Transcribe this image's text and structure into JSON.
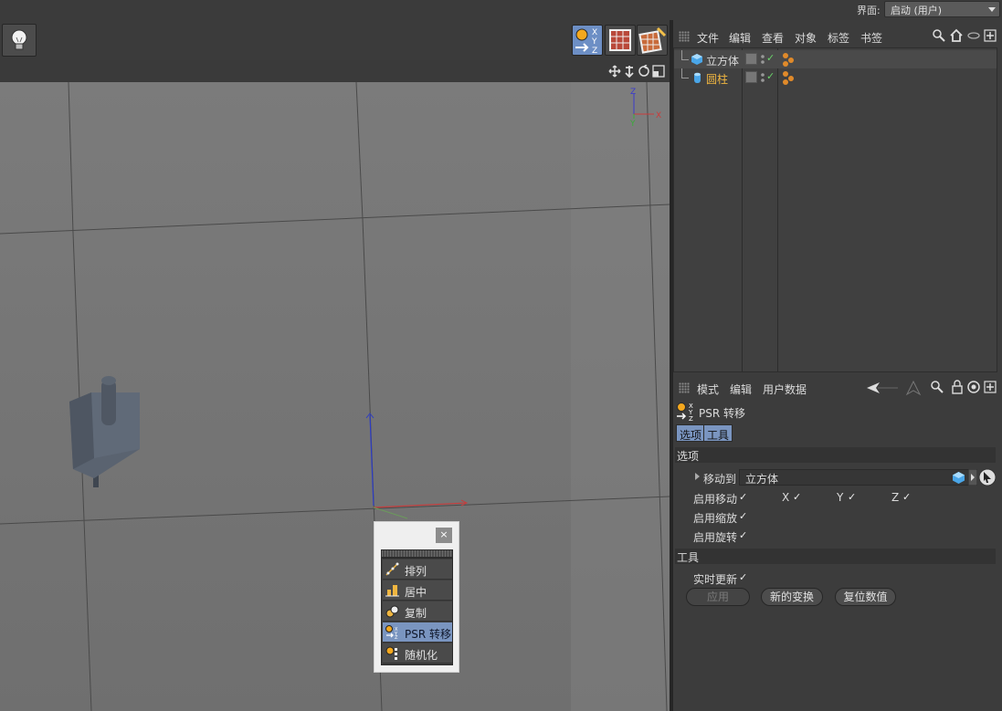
{
  "interface": {
    "label": "界面:",
    "value": "启动 (用户)"
  },
  "toolbar": {
    "light_icon": "lightbulb-icon",
    "psr_tool_icon": "psr-xyz-icon",
    "grid_tool_icon": "grid-red-icon",
    "paint_tool_icon": "paint-grid-icon"
  },
  "viewport": {
    "nav_icons": [
      "move-icon",
      "pan-down-icon",
      "rotate-icon",
      "maximize-icon"
    ],
    "axis": {
      "z": "Z",
      "x": "X",
      "y": "Y"
    }
  },
  "object_manager": {
    "menu": [
      "文件",
      "编辑",
      "查看",
      "对象",
      "标签",
      "书签"
    ],
    "objects": [
      {
        "name": "立方体",
        "color": "#d8d8d8",
        "icon": "cube-icon"
      },
      {
        "name": "圆柱",
        "color": "#f0b640",
        "icon": "cylinder-icon"
      }
    ]
  },
  "attribute_manager": {
    "menu": [
      "模式",
      "编辑",
      "用户数据"
    ],
    "title": "PSR 转移",
    "tabs": [
      "选项",
      "工具"
    ],
    "section_options": "选项",
    "move_to_label": "移动到",
    "move_to_value": "立方体",
    "enable_move": "启用移动",
    "x": "X",
    "y": "Y",
    "z": "Z",
    "enable_scale": "启用缩放",
    "enable_rotate": "启用旋转",
    "section_tool": "工具",
    "realtime_update": "实时更新",
    "buttons": {
      "apply": "应用",
      "new_transform": "新的变换",
      "reset": "复位数值"
    }
  },
  "palette": {
    "close": "×",
    "items": [
      {
        "label": "排列",
        "icon": "arrange-icon"
      },
      {
        "label": "居中",
        "icon": "center-icon"
      },
      {
        "label": "复制",
        "icon": "duplicate-icon"
      },
      {
        "label": "PSR 转移",
        "icon": "psr-transfer-icon",
        "selected": true
      },
      {
        "label": "随机化",
        "icon": "randomize-icon"
      }
    ]
  },
  "colors": {
    "accent_blue": "#7a95c0",
    "cylinder_orange": "#f0b640",
    "check_green": "#6ad36a"
  }
}
